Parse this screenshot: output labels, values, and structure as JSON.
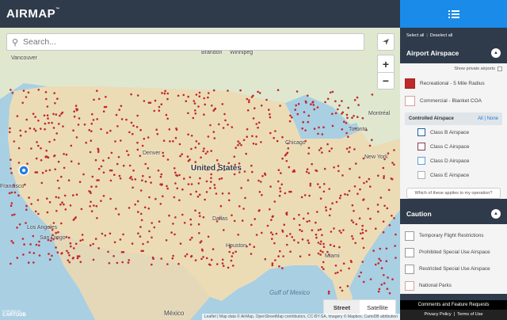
{
  "app": {
    "logo": "AIRMAP",
    "logo_mark": "™"
  },
  "search": {
    "placeholder": "Search..."
  },
  "map": {
    "country_label": "United States",
    "labels": {
      "vancouver": "Vancouver",
      "sanfrancisco": "Francisco",
      "losangeles": "Los Angeles",
      "sandiego": "San Diego",
      "brandon": "Brandon",
      "winnipeg": "Winnipeg",
      "toronto": "Toronto",
      "montreal": "Montréal",
      "mexico": "México",
      "gulf": "Gulf of\nMexico",
      "miami": "Miami",
      "houston": "Houston",
      "dallas": "Dallas",
      "denver": "Denver",
      "chicago": "Chicago",
      "newyork": "New York"
    },
    "basemap_options": {
      "street": "Street",
      "satellite": "Satellite"
    },
    "attribution": "Leaflet | Map data © AirMap, OpenStreetMap contributors, CC-BY-SA, Imagery © Mapbox, CartoDB attribution",
    "carto": "CARTODB",
    "carto_small": "POWERED BY"
  },
  "sidebar": {
    "select_all": "Select all",
    "deselect_all": "Deselect all",
    "airport_section": {
      "title": "Airport Airspace",
      "show_private": "Show private airports",
      "options": [
        {
          "label": "Recreational - 5 Mile Radius"
        },
        {
          "label": "Commercial - Blanket COA"
        }
      ],
      "controlled": {
        "title": "Controlled Airspace",
        "all": "All",
        "none": "None",
        "classes": [
          {
            "label": "Class B Airspace",
            "color": "#1f5fa8"
          },
          {
            "label": "Class C Airspace",
            "color": "#8a3a5a"
          },
          {
            "label": "Class D Airspace",
            "color": "#5aa0d8"
          },
          {
            "label": "Class E Airspace",
            "color": "#b0b0b0"
          }
        ]
      },
      "which_button": "Which of these applies to my operation?"
    },
    "caution_section": {
      "title": "Caution",
      "options": [
        {
          "label": "Temporary Flight Restrictions"
        },
        {
          "label": "Prohibited Special Use Airspace"
        },
        {
          "label": "Restricted Special Use Airspace"
        },
        {
          "label": "National Parks"
        }
      ]
    },
    "footer": {
      "comments": "Comments and Feature Requests",
      "privacy": "Privacy Policy",
      "terms": "Terms of Use"
    }
  },
  "colors": {
    "accent": "#1a8be8",
    "dark": "#2f3b4a",
    "airport_dot": "#c0292a"
  }
}
